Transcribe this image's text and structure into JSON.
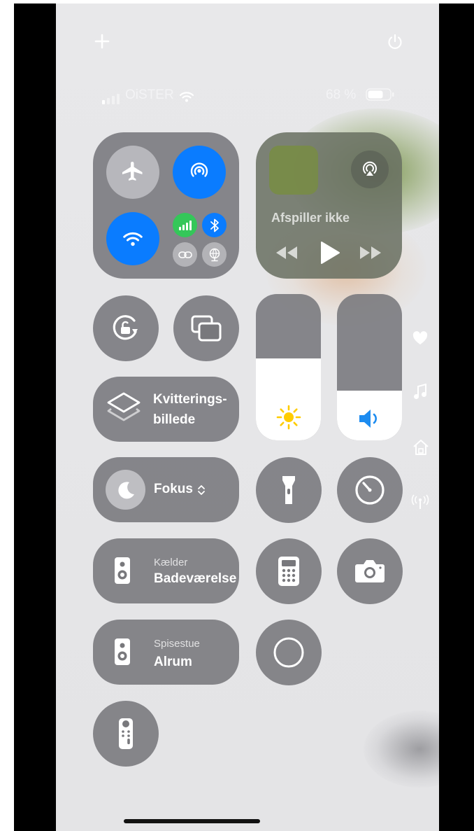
{
  "status_bar": {
    "carrier": "OiSTER",
    "battery_percent": "68 %"
  },
  "media": {
    "now_playing": "Afspiller ikke"
  },
  "tiles": {
    "screen_mirroring_label_1": "Kvitterings-",
    "screen_mirroring_label_2": "billede",
    "focus_label": "Fokus",
    "focus_chevron": "⌃⌄",
    "speaker1_room": "Kælder",
    "speaker1_name": "Badeværelse",
    "speaker2_room": "Spisestue",
    "speaker2_name": "Alrum"
  },
  "levels": {
    "brightness_fraction": 0.56,
    "volume_fraction": 0.34
  },
  "colors": {
    "accent_blue": "#0a7cff",
    "cellular_green": "#34c759",
    "tile_gray": "#78787c",
    "sun_yellow": "#ffcc00",
    "volume_blue": "#1d8cf0"
  },
  "icons": [
    "plus-icon",
    "power-icon",
    "airplane-icon",
    "airdrop-icon",
    "wifi-icon",
    "cellular-icon",
    "bluetooth-icon",
    "personal-hotspot-icon",
    "vpn-globe-icon",
    "airplay-icon",
    "rewind-icon",
    "play-icon",
    "fast-forward-icon",
    "rotation-lock-icon",
    "screen-mirroring-icon",
    "layers-icon",
    "sun-icon",
    "speaker-volume-icon",
    "heart-icon",
    "music-note-icon",
    "home-icon",
    "antenna-icon",
    "moon-icon",
    "flashlight-icon",
    "timer-icon",
    "speaker-icon",
    "calculator-icon",
    "camera-icon",
    "record-icon",
    "remote-icon"
  ]
}
